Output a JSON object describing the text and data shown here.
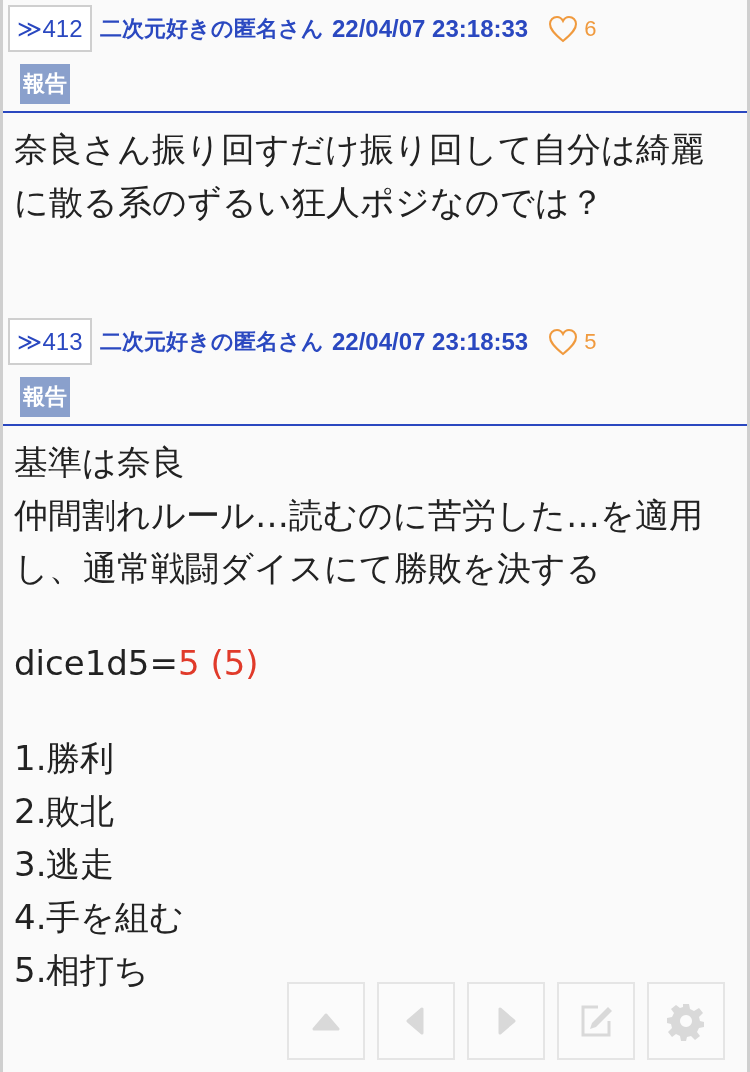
{
  "posts": [
    {
      "number": "≫412",
      "author": "二次元好きの匿名さん",
      "timestamp": "22/04/07 23:18:33",
      "likes": "6",
      "liked": false,
      "report": "報告",
      "paragraphs": [
        [
          [
            {
              "text": "奈良さん振り回すだけ振り回して自分は綺麗に散る系のずるい狂人ポジなのでは？"
            }
          ]
        ]
      ]
    },
    {
      "number": "≫413",
      "author": "二次元好きの匿名さん",
      "timestamp": "22/04/07 23:18:53",
      "likes": "5",
      "liked": false,
      "report": "報告",
      "paragraphs": [
        [
          [
            {
              "text": "基準は奈良"
            }
          ],
          [
            {
              "text": "仲間割れルール…読むのに苦労した…を適用し、通常戦闘ダイスにて勝敗を決する"
            }
          ]
        ],
        [
          [
            {
              "text": "dice1d5="
            },
            {
              "text": "5 (5)",
              "kind": "dice-result"
            }
          ]
        ],
        [
          [
            {
              "text": "1.勝利"
            }
          ],
          [
            {
              "text": "2.敗北"
            }
          ],
          [
            {
              "text": "3.逃走"
            }
          ],
          [
            {
              "text": "4.手を組む"
            }
          ],
          [
            {
              "text": "5.相打ち"
            }
          ]
        ]
      ]
    }
  ],
  "nav": [
    {
      "kind": "top"
    },
    {
      "kind": "prev"
    },
    {
      "kind": "next"
    },
    {
      "kind": "write"
    },
    {
      "kind": "settings"
    }
  ]
}
